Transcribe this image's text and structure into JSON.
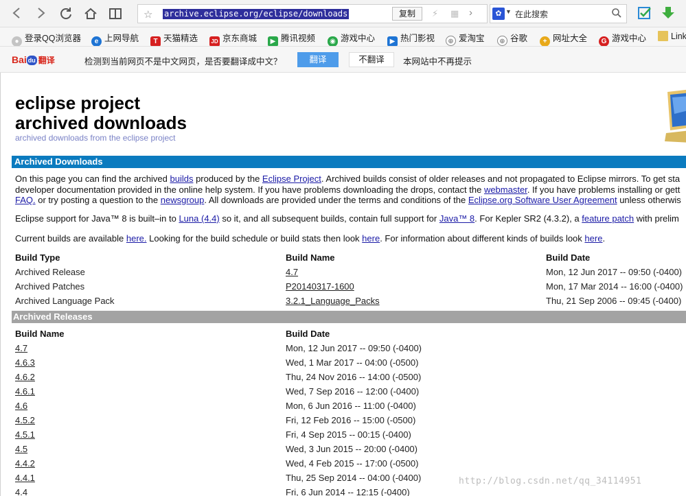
{
  "toolbar": {
    "url": "archive.eclipse.org/eclipse/downloads",
    "copy_label": "复制",
    "search_placeholder": "在此搜索"
  },
  "bookmarks": [
    {
      "label": "登录QQ浏览器",
      "icon": "user-icon",
      "color": "#bbbbbb"
    },
    {
      "label": "上网导航",
      "icon": "ie-icon",
      "color": "#1e74d4"
    },
    {
      "label": "天猫精选",
      "icon": "tmall-icon",
      "color": "#d62020"
    },
    {
      "label": "京东商城",
      "icon": "jd-icon",
      "color": "#d62020"
    },
    {
      "label": "腾讯视频",
      "icon": "play-icon",
      "color": "#2aa84a"
    },
    {
      "label": "游戏中心",
      "icon": "gamepad-icon",
      "color": "#2aa84a"
    },
    {
      "label": "热门影视",
      "icon": "video-icon",
      "color": "#1e74d4"
    },
    {
      "label": "爱淘宝",
      "icon": "globe-icon",
      "color": "#888888"
    },
    {
      "label": "谷歌",
      "icon": "globe-icon",
      "color": "#888888"
    },
    {
      "label": "网址大全",
      "icon": "plus-icon",
      "color": "#e8a91a"
    },
    {
      "label": "游戏中心",
      "icon": "game-center-icon",
      "color": "#d62020"
    },
    {
      "label": "Link",
      "icon": "folder-icon",
      "color": "#e6c35a"
    }
  ],
  "translate": {
    "logo_bai": "Bai",
    "logo_du": "du",
    "logo_fy": "翻译",
    "prompt": "检测到当前网页不是中文网页，是否要翻译成中文？",
    "translate_label": "翻译",
    "no_translate_label": "不翻译",
    "never_label": "本网站中不再提示"
  },
  "page": {
    "title_line1": "eclipse project",
    "title_line2": "archived downloads",
    "subtitle": "archived downloads from the eclipse project",
    "section1": "Archived Downloads",
    "section2": "Archived Releases",
    "p1": [
      [
        "On this page you can find the archived ",
        ""
      ],
      [
        "builds",
        "link"
      ],
      [
        " produced by the ",
        ""
      ],
      [
        "Eclipse Project",
        "link"
      ],
      [
        ". Archived builds consist of older releases and not propagated to Eclipse mirrors. To get sta",
        ""
      ]
    ],
    "p1b": [
      [
        "developer documentation provided in the online help system. If you have problems downloading the drops, contact the ",
        ""
      ],
      [
        "webmaster",
        "link"
      ],
      [
        ". If you have problems installing or gett",
        ""
      ]
    ],
    "p1c": [
      [
        "FAQ.",
        "link"
      ],
      [
        " or try posting a question to the ",
        ""
      ],
      [
        "newsgroup",
        "link"
      ],
      [
        ". All downloads are provided under the terms and conditions of the ",
        ""
      ],
      [
        "Eclipse.org Software User Agreement",
        "link"
      ],
      [
        " unless otherwis",
        ""
      ]
    ],
    "p2": [
      [
        "Eclipse support for Java™ 8 is built–in to ",
        ""
      ],
      [
        "Luna (4.4)",
        "link"
      ],
      [
        " so it, and all subsequent builds, contain full support for ",
        ""
      ],
      [
        "Java™ 8",
        "link"
      ],
      [
        ". For Kepler SR2 (4.3.2), a ",
        ""
      ],
      [
        "feature patch",
        "link"
      ],
      [
        " with prelim",
        ""
      ]
    ],
    "p3": [
      [
        "Current builds are available ",
        ""
      ],
      [
        "here.",
        "link"
      ],
      [
        " Looking for the build schedule or build stats then look ",
        ""
      ],
      [
        "here",
        "link"
      ],
      [
        ". For information about different kinds of builds look ",
        ""
      ],
      [
        "here",
        "link"
      ],
      [
        ".",
        ""
      ]
    ],
    "builds_table": {
      "headers": [
        "Build Type",
        "Build Name",
        "Build Date"
      ],
      "rows": [
        [
          "Archived Release",
          "4.7",
          "Mon, 12 Jun 2017 -- 09:50 (-0400)"
        ],
        [
          "Archived Patches",
          "P20140317-1600",
          "Mon, 17 Mar 2014 -- 16:00 (-0400)"
        ],
        [
          "Archived Language Pack",
          "3.2.1_Language_Packs",
          "Thu, 21 Sep 2006 -- 09:45 (-0400)"
        ]
      ]
    },
    "releases_table": {
      "headers": [
        "Build Name",
        "Build Date"
      ],
      "rows": [
        [
          "4.7",
          "Mon, 12 Jun 2017 -- 09:50 (-0400)"
        ],
        [
          "4.6.3",
          "Wed, 1 Mar 2017 -- 04:00 (-0500)"
        ],
        [
          "4.6.2",
          "Thu, 24 Nov 2016 -- 14:00 (-0500)"
        ],
        [
          "4.6.1",
          "Wed, 7 Sep 2016 -- 12:00 (-0400)"
        ],
        [
          "4.6",
          "Mon, 6 Jun 2016 -- 11:00 (-0400)"
        ],
        [
          "4.5.2",
          "Fri, 12 Feb 2016 -- 15:00 (-0500)"
        ],
        [
          "4.5.1",
          "Fri, 4 Sep 2015 -- 00:15 (-0400)"
        ],
        [
          "4.5",
          "Wed, 3 Jun 2015 -- 20:00 (-0400)"
        ],
        [
          "4.4.2",
          "Wed, 4 Feb 2015 -- 17:00 (-0500)"
        ],
        [
          "4.4.1",
          "Thu, 25 Sep 2014 -- 04:00 (-0400)"
        ],
        [
          "4.4",
          "Fri, 6 Jun 2014 -- 12:15 (-0400)"
        ]
      ]
    }
  },
  "watermark": "http://blog.csdn.net/qq_34114951"
}
